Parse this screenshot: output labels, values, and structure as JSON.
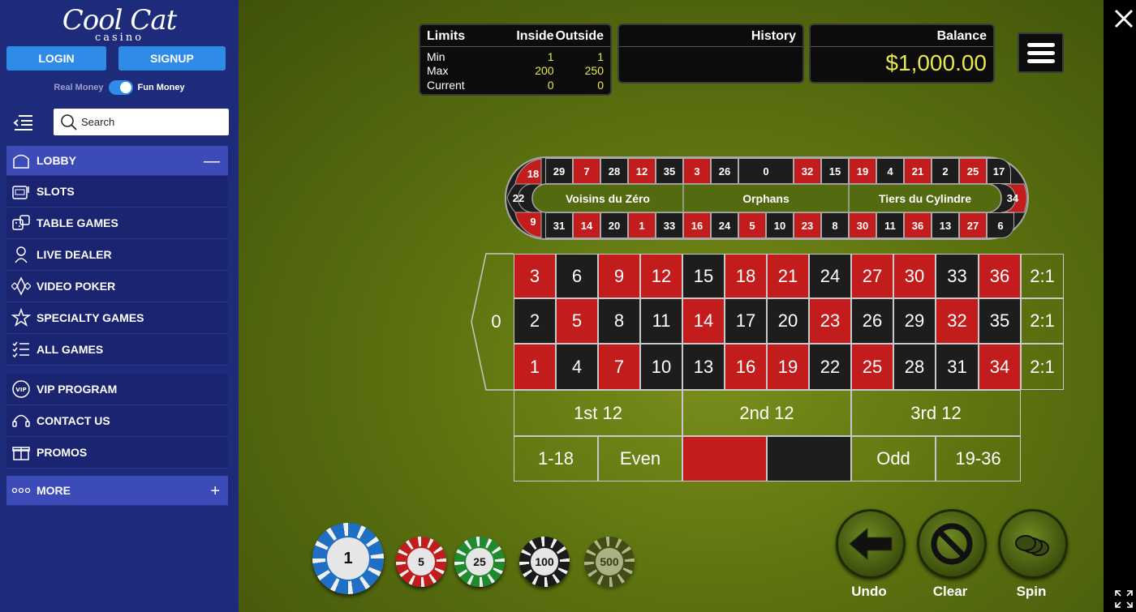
{
  "sidebar": {
    "logo": {
      "main": "Cool Cat",
      "sub": "casino"
    },
    "login_label": "LOGIN",
    "signup_label": "SIGNUP",
    "money": {
      "real": "Real Money",
      "fun": "Fun Money"
    },
    "search_placeholder": "Search",
    "nav_main": [
      {
        "label": "LOBBY",
        "icon": "lobby-icon",
        "right": "—"
      },
      {
        "label": "SLOTS",
        "icon": "slots-icon"
      },
      {
        "label": "TABLE GAMES",
        "icon": "dice-icon"
      },
      {
        "label": "LIVE DEALER",
        "icon": "dealer-icon"
      },
      {
        "label": "VIDEO POKER",
        "icon": "cards-icon"
      },
      {
        "label": "SPECIALTY GAMES",
        "icon": "star-icon"
      },
      {
        "label": "ALL GAMES",
        "icon": "list-icon"
      }
    ],
    "nav_second": [
      {
        "label": "VIP PROGRAM",
        "icon": "vip-icon"
      },
      {
        "label": "CONTACT US",
        "icon": "headset-icon"
      },
      {
        "label": "PROMOS",
        "icon": "gift-icon"
      }
    ],
    "more": {
      "label": "MORE",
      "right": "+"
    }
  },
  "limits": {
    "title": "Limits",
    "col_inside": "Inside",
    "col_outside": "Outside",
    "rows": [
      {
        "label": "Min",
        "inside": "1",
        "outside": "1"
      },
      {
        "label": "Max",
        "inside": "200",
        "outside": "250"
      },
      {
        "label": "Current",
        "inside": "0",
        "outside": "0"
      }
    ]
  },
  "history": {
    "title": "History"
  },
  "balance": {
    "title": "Balance",
    "amount": "$1,000.00"
  },
  "racetrack": {
    "top": [
      "18",
      "29",
      "7",
      "28",
      "12",
      "35",
      "3",
      "26",
      "0",
      "32",
      "15",
      "19",
      "4",
      "21",
      "2",
      "25",
      "17"
    ],
    "bottom": [
      "9",
      "31",
      "14",
      "20",
      "1",
      "33",
      "16",
      "24",
      "5",
      "10",
      "23",
      "8",
      "30",
      "11",
      "36",
      "13",
      "27",
      "6"
    ],
    "left": "22",
    "right": "34",
    "sectors": [
      "Voisins du Zéro",
      "Orphans",
      "Tiers du Cylindre"
    ]
  },
  "table": {
    "zero": "0",
    "rows": [
      [
        "3",
        "6",
        "9",
        "12",
        "15",
        "18",
        "21",
        "24",
        "27",
        "30",
        "33",
        "36"
      ],
      [
        "2",
        "5",
        "8",
        "11",
        "14",
        "17",
        "20",
        "23",
        "26",
        "29",
        "32",
        "35"
      ],
      [
        "1",
        "4",
        "7",
        "10",
        "13",
        "16",
        "19",
        "22",
        "25",
        "28",
        "31",
        "34"
      ]
    ],
    "column_bets": [
      "2:1",
      "2:1",
      "2:1"
    ],
    "dozens": [
      "1st 12",
      "2nd 12",
      "3rd 12"
    ],
    "outside": [
      "1-18",
      "Even",
      "",
      "",
      "Odd",
      "19-36"
    ],
    "red_numbers": [
      "1",
      "3",
      "5",
      "7",
      "9",
      "12",
      "14",
      "16",
      "18",
      "19",
      "21",
      "23",
      "25",
      "27",
      "30",
      "32",
      "34",
      "36"
    ],
    "colors": {
      "red": "#c21c1c",
      "black": "#1d1d1d"
    }
  },
  "chips": [
    {
      "value": "1",
      "color": "#1f6fc4"
    },
    {
      "value": "5",
      "color": "#c21c1c"
    },
    {
      "value": "25",
      "color": "#1f8a2e"
    },
    {
      "value": "100",
      "color": "#1a1a1a"
    },
    {
      "value": "500",
      "color": "#2e2a1a"
    }
  ],
  "actions": {
    "undo": "Undo",
    "clear": "Clear",
    "spin": "Spin"
  }
}
